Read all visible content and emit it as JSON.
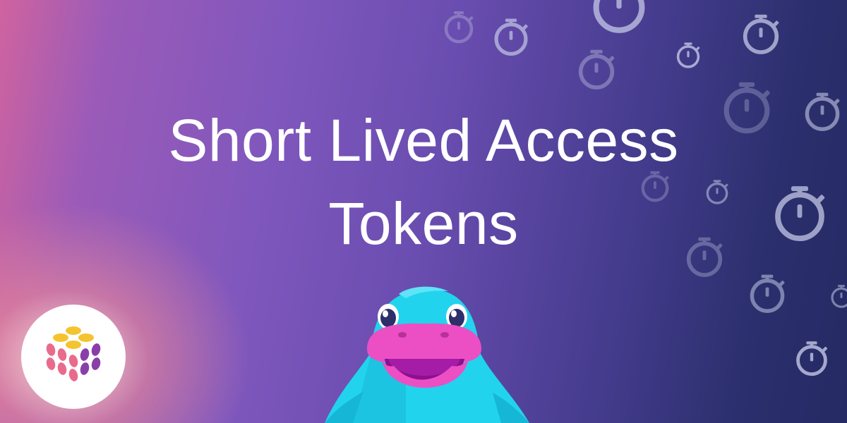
{
  "title": {
    "line1": "Short Lived Access",
    "line2": "Tokens"
  },
  "icons": {
    "background_pattern": "stopwatch-icon",
    "logo": "dotted-grid-logo",
    "mascot": "platypus-mascot"
  },
  "colors": {
    "gradient_left": "#d0639f",
    "gradient_mid": "#7f57bd",
    "gradient_right": "#252a64",
    "title_text": "#ffffff",
    "stopwatch": "#c4c8e6",
    "mascot_body": "#22d3ee",
    "mascot_beak": "#ec4fc4",
    "mascot_mouth": "#8d0f8f",
    "logo_yellow": "#f4c430",
    "logo_pink": "#e96b8c",
    "logo_purple": "#8a3fa8"
  }
}
